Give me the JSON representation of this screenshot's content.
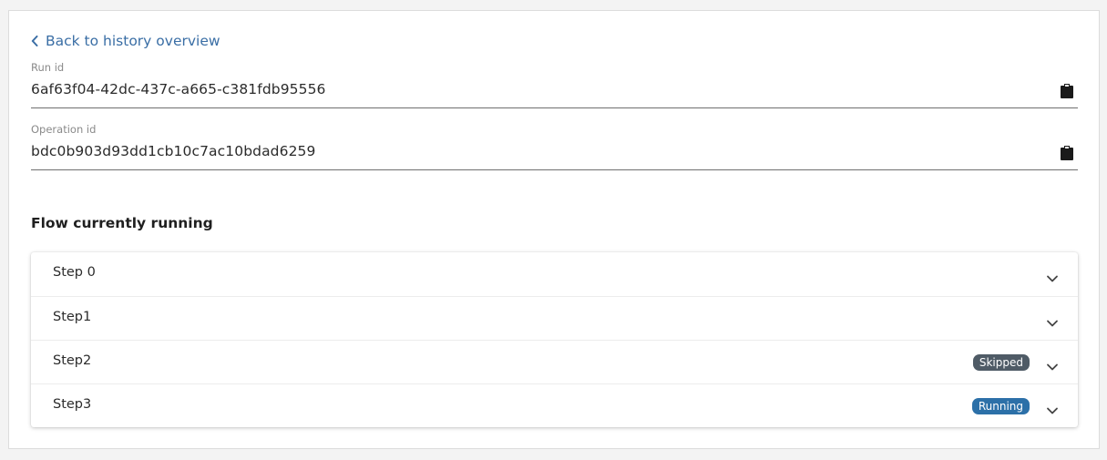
{
  "nav": {
    "back_label": "Back to history overview",
    "back_icon": "chevron-left-icon"
  },
  "run_id": {
    "label": "Run id",
    "value": "6af63f04-42dc-437c-a665-c381fdb95556",
    "copy_icon": "clipboard-icon"
  },
  "operation_id": {
    "label": "Operation id",
    "value": "bdc0b903d93dd1cb10c7ac10bdad6259",
    "copy_icon": "clipboard-icon"
  },
  "flow": {
    "title": "Flow currently running",
    "steps": [
      {
        "label": "Step 0",
        "status": null
      },
      {
        "label": "Step1",
        "status": null
      },
      {
        "label": "Step2",
        "status": "Skipped"
      },
      {
        "label": "Step3",
        "status": "Running"
      }
    ]
  },
  "colors": {
    "link": "#3a6ea5",
    "badge_skipped": "#4f5b66",
    "badge_running": "#2c70a8"
  }
}
